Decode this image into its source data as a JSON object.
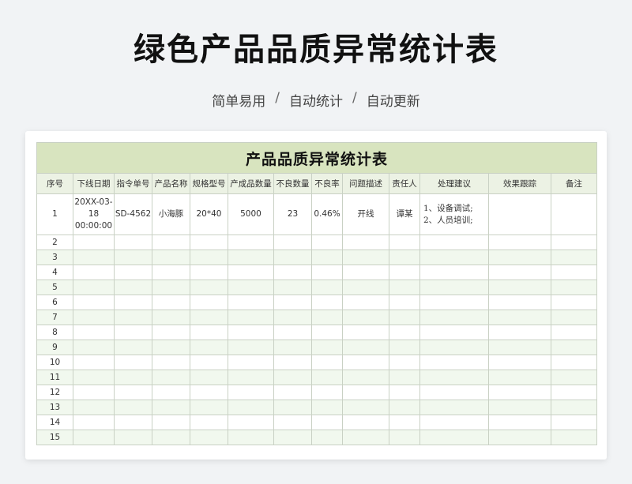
{
  "page": {
    "title": "绿色产品品质异常统计表",
    "subtitle_parts": [
      "简单易用",
      "自动统计",
      "自动更新"
    ],
    "separator": "/"
  },
  "sheet": {
    "title": "产品品质异常统计表",
    "headers": [
      "序号",
      "下线日期",
      "指令单号",
      "产品名称",
      "规格型号",
      "产成品数量",
      "不良数量",
      "不良率",
      "问题描述",
      "责任人",
      "处理建议",
      "效果跟踪",
      "备注"
    ],
    "first_row": {
      "no": "1",
      "date": "20XX-03-18 00:00:00",
      "order": "SD-4562",
      "product": "小海豚",
      "spec": "20*40",
      "qty": "5000",
      "defects": "23",
      "rate": "0.46%",
      "issue": "开线",
      "owner": "谭某",
      "suggestion_1": "1、设备调试;",
      "suggestion_2": "2、人员培训;",
      "tracking": "",
      "remarks": ""
    },
    "row_numbers": [
      "2",
      "3",
      "4",
      "5",
      "6",
      "7",
      "8",
      "9",
      "10",
      "11",
      "12",
      "13",
      "14",
      "15"
    ]
  },
  "colors": {
    "title_band": "#d8e4bf",
    "header_row": "#ecf2e4",
    "alt_row": "#f1f8ee",
    "grid": "#c9d1c4"
  }
}
